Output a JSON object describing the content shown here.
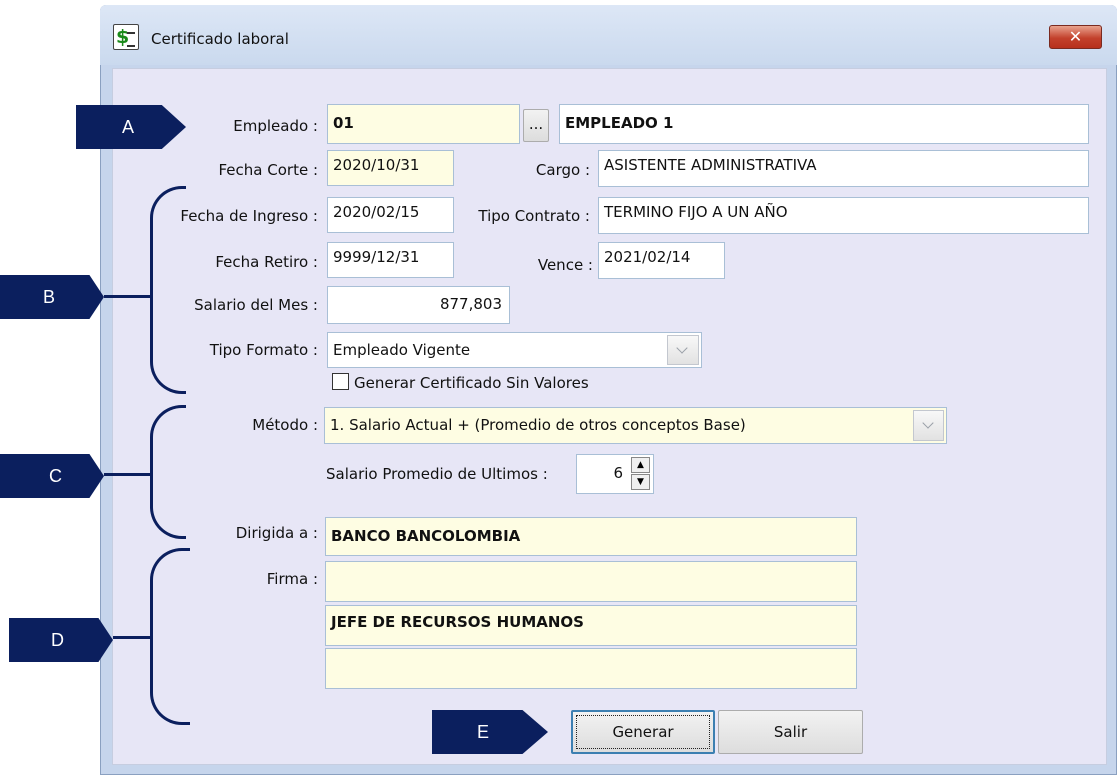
{
  "window": {
    "title": "Certificado laboral",
    "close": "✕"
  },
  "fields": {
    "empleado": {
      "label": "Empleado :",
      "code": "01",
      "browse": "...",
      "name": "EMPLEADO 1"
    },
    "fecha_corte": {
      "label": "Fecha Corte :",
      "value": "2020/10/31"
    },
    "cargo": {
      "label": "Cargo :",
      "value": "ASISTENTE ADMINISTRATIVA"
    },
    "fecha_ingreso": {
      "label": "Fecha de Ingreso :",
      "value": "2020/02/15"
    },
    "tipo_contrato": {
      "label": "Tipo Contrato :",
      "value": "TERMINO FIJO A UN AÑO"
    },
    "fecha_retiro": {
      "label": "Fecha Retiro :",
      "value": "9999/12/31"
    },
    "vence": {
      "label": "Vence :",
      "value": "2021/02/14"
    },
    "salario_mes": {
      "label": "Salario del Mes :",
      "value": "877,803"
    },
    "tipo_formato": {
      "label": "Tipo Formato :",
      "value": "Empleado Vigente"
    },
    "sin_valores": {
      "label": "Generar Certificado Sin Valores",
      "checked": false
    },
    "metodo": {
      "label": "Método :",
      "value": "1. Salario Actual + (Promedio de otros conceptos Base)"
    },
    "salario_promedio": {
      "label": "Salario Promedio de Ultimos :",
      "value": "6"
    },
    "dirigida": {
      "label": "Dirigida a :",
      "value": "BANCO BANCOLOMBIA"
    },
    "firma": {
      "label": "Firma :",
      "line1": "",
      "line2": "JEFE DE RECURSOS HUMANOS",
      "line3": ""
    }
  },
  "buttons": {
    "generar": "Generar",
    "salir": "Salir"
  },
  "annotations": {
    "a": "A",
    "b": "B",
    "c": "C",
    "d": "D",
    "e": "E",
    "color": "#0b1f5e"
  }
}
